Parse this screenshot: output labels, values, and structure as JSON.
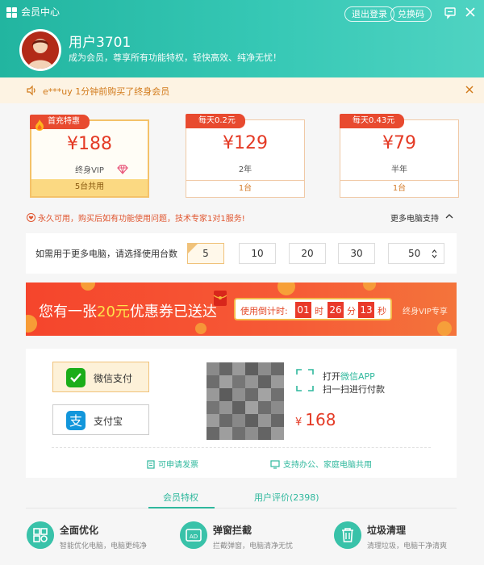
{
  "window": {
    "title": "会员中心",
    "logout_label": "退出登录",
    "redeem_label": "兑换码"
  },
  "user": {
    "name": "用户3701",
    "subtitle": "成为会员，尊享所有功能特权，轻快高效、纯净无忧！"
  },
  "notice": {
    "text": "e***uy 1分钟前购买了终身会员"
  },
  "plans": [
    {
      "badge": "首充特惠",
      "price": "¥188",
      "term": "终身VIP",
      "footer": "5台共用"
    },
    {
      "badge": "每天0.2元",
      "price": "¥129",
      "term": "2年",
      "footer": "1台"
    },
    {
      "badge": "每天0.43元",
      "price": "¥79",
      "term": "半年",
      "footer": "1台"
    }
  ],
  "info": {
    "text": "永久可用，购买后如有功能使用问题，技术专家1对1服务!",
    "more_support": "更多电脑支持"
  },
  "devices": {
    "label": "如需用于更多电脑，请选择使用台数",
    "options": [
      "5",
      "10",
      "20",
      "30"
    ],
    "select_value": "50"
  },
  "coupon": {
    "text_before": "您有一张",
    "amount": "20元",
    "text_after": "优惠券已送达",
    "timer_label": "使用倒计时:",
    "hours": "01",
    "h_unit": "时",
    "minutes": "26",
    "m_unit": "分",
    "seconds": "13",
    "s_unit": "秒",
    "vip_only": "终身VIP专享"
  },
  "payment": {
    "wechat_label": "微信支付",
    "alipay_label": "支付宝",
    "scan_open": "打开",
    "scan_app": "微信APP",
    "scan_line2": "扫一扫进行付款",
    "currency": "¥",
    "price": "168",
    "invoice_link": "可申请发票",
    "multi_link": "支持办公、家庭电脑共用"
  },
  "tabs": [
    {
      "label": "会员特权"
    },
    {
      "label": "用户评价(2398)"
    }
  ],
  "features": [
    {
      "title": "全面优化",
      "desc": "智能优化电脑，电脑更纯净"
    },
    {
      "title": "弹窗拦截",
      "desc": "拦截弹窗，电脑清净无忧"
    },
    {
      "title": "垃圾清理",
      "desc": "清理垃圾，电脑干净清爽"
    }
  ],
  "colors": {
    "teal": "#2fb89d",
    "price_red": "#e43a25",
    "badge_red": "#e84a2f",
    "gold": "#fbd982"
  }
}
